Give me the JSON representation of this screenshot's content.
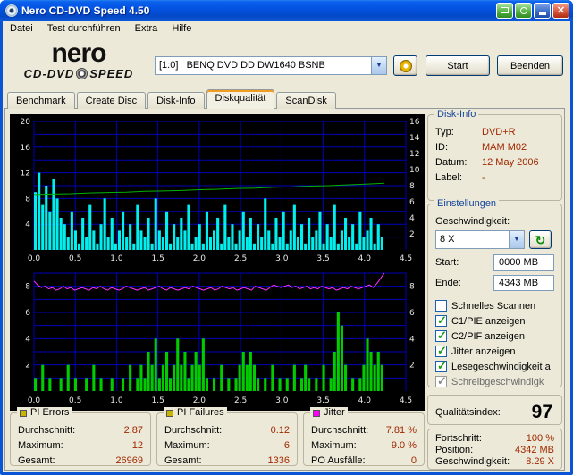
{
  "window": {
    "title": "Nero CD-DVD Speed 4.50"
  },
  "menu": {
    "items": [
      "Datei",
      "Test durchführen",
      "Extra",
      "Hilfe"
    ]
  },
  "header": {
    "logo": {
      "name": "nero",
      "sub1": "CD-DVD",
      "sub2": "SPEED"
    },
    "drive_select_value": "[1:0]   BENQ DVD DD DW1640 BSNB",
    "start_button": "Start",
    "quit_button": "Beenden"
  },
  "tabs": [
    {
      "label": "Benchmark",
      "active": false
    },
    {
      "label": "Create Disc",
      "active": false
    },
    {
      "label": "Disk-Info",
      "active": false
    },
    {
      "label": "Diskqualität",
      "active": true
    },
    {
      "label": "ScanDisk",
      "active": false
    }
  ],
  "disk_info": {
    "title": "Disk-Info",
    "rows": [
      {
        "label": "Typ:",
        "value": "DVD+R"
      },
      {
        "label": "ID:",
        "value": "MAM M02"
      },
      {
        "label": "Datum:",
        "value": "12 May 2006"
      },
      {
        "label": "Label:",
        "value": "-"
      }
    ]
  },
  "settings": {
    "title": "Einstellungen",
    "speed_label": "Geschwindigkeit:",
    "speed_value": "8 X",
    "start_label": "Start:",
    "start_value": "0000 MB",
    "end_label": "Ende:",
    "end_value": "4343 MB",
    "checkboxes": [
      {
        "label": "Schnelles Scannen",
        "checked": false,
        "disabled": false
      },
      {
        "label": "C1/PIE anzeigen",
        "checked": true,
        "disabled": false
      },
      {
        "label": "C2/PIF anzeigen",
        "checked": true,
        "disabled": false
      },
      {
        "label": "Jitter anzeigen",
        "checked": true,
        "disabled": false
      },
      {
        "label": "Lesegeschwindigkeit a",
        "checked": true,
        "disabled": false
      },
      {
        "label": "Schreibgeschwindigk",
        "checked": true,
        "disabled": true
      }
    ]
  },
  "quality": {
    "label": "Qualitätsindex:",
    "value": "97"
  },
  "progress": {
    "rows": [
      {
        "label": "Fortschritt:",
        "value": "100 %"
      },
      {
        "label": "Position:",
        "value": "4342 MB"
      },
      {
        "label": "Geschwindigkeit:",
        "value": "8.29 X"
      }
    ]
  },
  "stats": {
    "pi_errors": {
      "title": "PI Errors",
      "legend_color": "#C9B500",
      "rows": [
        {
          "label": "Durchschnitt:",
          "value": "2.87"
        },
        {
          "label": "Maximum:",
          "value": "12"
        },
        {
          "label": "Gesamt:",
          "value": "26969"
        }
      ]
    },
    "pi_failures": {
      "title": "PI Failures",
      "legend_color": "#C9B500",
      "rows": [
        {
          "label": "Durchschnitt:",
          "value": "0.12"
        },
        {
          "label": "Maximum:",
          "value": "6"
        },
        {
          "label": "Gesamt:",
          "value": "1336"
        }
      ]
    },
    "jitter": {
      "title": "Jitter",
      "legend_color": "#FF00FF",
      "rows": [
        {
          "label": "Durchschnitt:",
          "value": "7.81 %"
        },
        {
          "label": "Maximum:",
          "value": "9.0 %"
        },
        {
          "label": "PO Ausfälle:",
          "value": "0"
        }
      ]
    }
  },
  "colors": {
    "titlebar_blue": "#0453E3",
    "window_bg": "#ECE9D8",
    "chart_bg": "#000000",
    "grid_blue": "#0000B8",
    "pie_cyan": "#00F0F0",
    "pif_green": "#00CC00",
    "speed_green": "#00B400",
    "jitter_magenta": "#FF30FF",
    "value_text": "#A02800",
    "group_caption_blue": "#16469C",
    "check_green": "#1A9C1A"
  },
  "chart_data": [
    {
      "type": "bar",
      "name": "PI Errors / Lesegeschwindigkeit",
      "grid_color": "#0000B8",
      "x_unit": "GB",
      "x_ticks": [
        "0.0",
        "0.5",
        "1.0",
        "1.5",
        "2.0",
        "2.5",
        "3.0",
        "3.5",
        "4.0",
        "4.5"
      ],
      "data_end_fraction": 0.942,
      "y_left": {
        "max": 20,
        "grid_step": 2,
        "tick_labels": [
          "20",
          "16",
          "12",
          "8",
          "4"
        ]
      },
      "y_right": {
        "max": 16,
        "tick_labels": [
          "16",
          "14",
          "12",
          "10",
          "8",
          "6",
          "4",
          "2"
        ]
      },
      "series": [
        {
          "name": "PI Errors",
          "type": "bars",
          "axis": "left",
          "color": "#00F0F0",
          "values": [
            9,
            12,
            7,
            10,
            6,
            11,
            8,
            5,
            4,
            2,
            6,
            3,
            1,
            5,
            2,
            7,
            3,
            1,
            4,
            8,
            2,
            5,
            1,
            3,
            6,
            2,
            4,
            1,
            7,
            3,
            2,
            5,
            1,
            8,
            3,
            2,
            6,
            1,
            4,
            2,
            5,
            3,
            7,
            1,
            2,
            4,
            1,
            6,
            2,
            3,
            5,
            1,
            7,
            2,
            4,
            1,
            3,
            6,
            2,
            5,
            1,
            4,
            2,
            8,
            3,
            1,
            5,
            2,
            6,
            1,
            3,
            7,
            2,
            4,
            1,
            5,
            2,
            3,
            6,
            1,
            4,
            2,
            7,
            1,
            3,
            5,
            2,
            4,
            1,
            6,
            2,
            3,
            5,
            1,
            4,
            2
          ]
        },
        {
          "name": "Lesegeschwindigkeit (X)",
          "type": "line",
          "axis": "right",
          "color": "#00B400",
          "values": [
            6.9,
            6.95,
            7.0,
            7.1,
            7.15,
            7.2,
            7.3,
            7.35,
            7.4,
            7.5,
            7.55,
            7.65,
            7.7,
            7.8,
            7.85,
            7.95,
            8.0,
            8.1,
            8.2,
            8.3
          ]
        }
      ]
    },
    {
      "type": "line",
      "name": "PI Failures / Jitter",
      "grid_color": "#0000B8",
      "x_unit": "GB",
      "x_ticks": [
        "0.0",
        "0.5",
        "1.0",
        "1.5",
        "2.0",
        "2.5",
        "3.0",
        "3.5",
        "4.0",
        "4.5"
      ],
      "data_end_fraction": 0.942,
      "y_left": {
        "max": 9,
        "grid_step": 1,
        "tick_labels": [
          "8",
          "6",
          "4",
          "2"
        ]
      },
      "y_right": {
        "max": 9,
        "tick_labels": [
          "8",
          "6",
          "4",
          "2"
        ]
      },
      "series": [
        {
          "name": "PI Failures",
          "type": "bars",
          "axis": "left",
          "color": "#00CC00",
          "values": [
            1,
            0,
            2,
            0,
            1,
            0,
            0,
            1,
            0,
            2,
            0,
            1,
            0,
            0,
            1,
            0,
            2,
            0,
            1,
            0,
            0,
            1,
            0,
            0,
            1,
            0,
            2,
            0,
            1,
            2,
            1,
            3,
            2,
            4,
            1,
            2,
            3,
            1,
            2,
            4,
            2,
            3,
            1,
            2,
            3,
            2,
            4,
            1,
            0,
            1,
            0,
            2,
            0,
            1,
            0,
            1,
            2,
            3,
            2,
            3,
            2,
            1,
            0,
            1,
            0,
            2,
            0,
            1,
            0,
            1,
            0,
            2,
            0,
            1,
            2,
            1,
            0,
            1,
            0,
            2,
            0,
            1,
            3,
            6,
            5,
            2,
            0,
            1,
            0,
            1,
            2,
            4,
            3,
            2,
            3,
            2
          ]
        },
        {
          "name": "Jitter (%)",
          "type": "line",
          "axis": "left",
          "color": "#FF30FF",
          "values": [
            8.4,
            8.1,
            7.9,
            8.0,
            7.8,
            7.9,
            7.7,
            7.8,
            8.0,
            7.8,
            7.9,
            7.7,
            7.8,
            7.9,
            7.8,
            7.7,
            7.9,
            7.8,
            8.0,
            7.8,
            7.7,
            7.9,
            7.8,
            7.7,
            7.8,
            8.0,
            7.9,
            7.8,
            7.7,
            7.8,
            7.9,
            7.7,
            7.8,
            7.9,
            8.0,
            7.8,
            7.7,
            7.9,
            7.8,
            7.7,
            7.8,
            7.9,
            7.8,
            8.0,
            7.9,
            7.8,
            7.7,
            7.8,
            7.9,
            7.7,
            7.8,
            8.0,
            7.9,
            7.8,
            7.9,
            7.7,
            7.8,
            7.9,
            7.8,
            7.7,
            8.0,
            7.9,
            7.8,
            7.7,
            7.9,
            8.1,
            8.0,
            7.9,
            8.0,
            8.1,
            7.9,
            8.0,
            7.8,
            7.9,
            8.0,
            7.8,
            7.9,
            7.8,
            8.0,
            7.9,
            7.8,
            7.9,
            7.7,
            7.8,
            7.9,
            7.8,
            8.0,
            7.9,
            7.8,
            7.9,
            8.0,
            8.1,
            7.9,
            8.2,
            8.6,
            9.0
          ]
        }
      ]
    }
  ]
}
